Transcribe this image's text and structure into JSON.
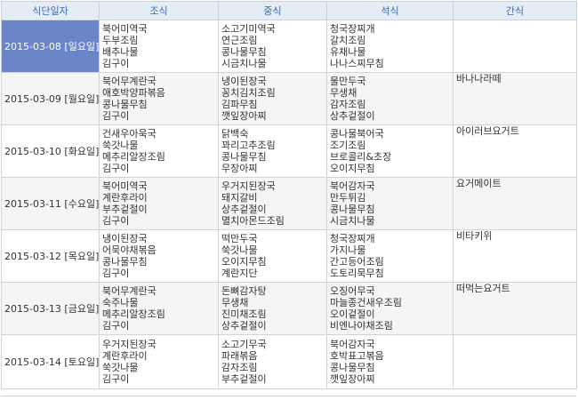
{
  "headers": [
    "식단일자",
    "조식",
    "중식",
    "석식",
    "간식"
  ],
  "selected_row": 0,
  "rows": [
    {
      "date": "2015-03-08 [일요일]",
      "breakfast": [
        "북어미역국",
        "두부조림",
        "배추나물",
        "김구이"
      ],
      "lunch": [
        "소고기미역국",
        "연근조림",
        "콩나물무침",
        "시금치나물"
      ],
      "dinner": [
        "청국장찌개",
        "갈치조림",
        "유채나물",
        "나나스찌무침"
      ],
      "snack": ""
    },
    {
      "date": "2015-03-09 [월요일]",
      "breakfast": [
        "북어무계란국",
        "애호박양파볶음",
        "콩나물무침",
        "김구이"
      ],
      "lunch": [
        "냉이된장국",
        "꽁치김치조림",
        "김파무침",
        "깻잎장아찌"
      ],
      "dinner": [
        "물만두국",
        "무생채",
        "감자조림",
        "상추겉절이"
      ],
      "snack": "바나나라떼"
    },
    {
      "date": "2015-03-10 [화요일]",
      "breakfast": [
        "건새우아욱국",
        "쑥갓나물",
        "메추리알장조림",
        "김구이"
      ],
      "lunch": [
        "닭백숙",
        "꽈리고추조림",
        "콩나물무침",
        "무장아찌"
      ],
      "dinner": [
        "콩나물북어국",
        "조기조림",
        "브로콜리&초장",
        "오이지무침"
      ],
      "snack": "아이러브요거트"
    },
    {
      "date": "2015-03-11 [수요일]",
      "breakfast": [
        "북어미역국",
        "계란후라이",
        "부추겉절이",
        "김구이"
      ],
      "lunch": [
        "우거지된장국",
        "돼지갈비",
        "상추겉절이",
        "멸치아몬드조림"
      ],
      "dinner": [
        "북어감자국",
        "만두튀김",
        "콩나물무침",
        "시금치나물"
      ],
      "snack": "요거메이트"
    },
    {
      "date": "2015-03-12 [목요일]",
      "breakfast": [
        "냉이된장국",
        "어묵야채볶음",
        "콩나물무침",
        "김구이"
      ],
      "lunch": [
        "떡만두국",
        "쑥갓나물",
        "오이지무침",
        "계란지단"
      ],
      "dinner": [
        "청국장찌개",
        "가지나물",
        "간고등어조림",
        "도토리묵무침"
      ],
      "snack": "비타키위"
    },
    {
      "date": "2015-03-13 [금요일]",
      "breakfast": [
        "북어무계란국",
        "숙주나물",
        "메추리알장조림",
        "김구이"
      ],
      "lunch": [
        "돈뼈감자탕",
        "무생채",
        "진미채조림",
        "상추겉절이"
      ],
      "dinner": [
        "오징어무국",
        "마늘종건새우조림",
        "오이겉절이",
        "비엔나야채조림"
      ],
      "snack": "떠먹는요거트"
    },
    {
      "date": "2015-03-14 [토요일]",
      "breakfast": [
        "우거지된장국",
        "계란후라이",
        "쑥갓나물",
        "김구이"
      ],
      "lunch": [
        "소고기무국",
        "파래볶음",
        "감자조림",
        "부추겉절이"
      ],
      "dinner": [
        "북어감자국",
        "호박표고볶음",
        "콩나물무침",
        "깻잎장아찌"
      ],
      "snack": ""
    }
  ]
}
